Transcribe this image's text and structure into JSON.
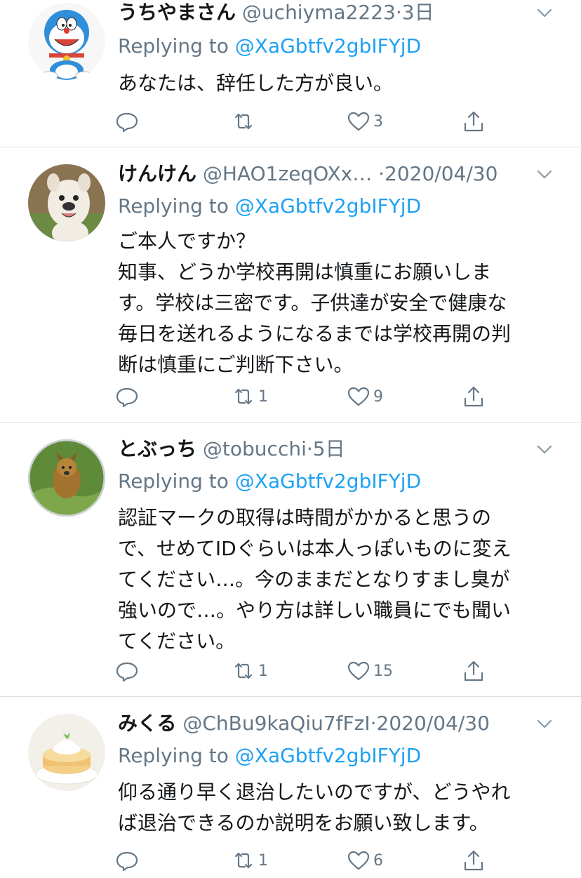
{
  "tweets": [
    {
      "name": "うちやまさん",
      "handle": "@uchiyma2223",
      "sep": "·",
      "time": "3日",
      "reply_prefix": "Replying to ",
      "reply_to": "@XaGbtfv2gbIFYjD",
      "lines": [
        "あなたは、辞任した方が良い。"
      ],
      "counts": {
        "reply": "",
        "retweet": "",
        "like": "3"
      },
      "avatar": "doraemon-avatar"
    },
    {
      "name": "けんけん",
      "handle": "@HAO1zeqOXx…",
      "sep": " ·",
      "time": "2020/04/30",
      "reply_prefix": "Replying to ",
      "reply_to": "@XaGbtfv2gbIFYjD",
      "lines": [
        "ご本人ですか？",
        "知事、どうか学校再開は慎重にお願いしま",
        "す。学校は三密です。子供達が安全で健康な",
        "毎日を送れるようになるまでは学校再開の判",
        "断は慎重にご判断下さい。"
      ],
      "counts": {
        "reply": "",
        "retweet": "1",
        "like": "9"
      },
      "avatar": "bulldog-avatar"
    },
    {
      "name": "とぶっち",
      "handle": "@tobucchi",
      "sep": "·",
      "time": "5日",
      "reply_prefix": "Replying to ",
      "reply_to": "@XaGbtfv2gbIFYjD",
      "lines": [
        "認証マークの取得は時間がかかると思うの",
        "で、せめてIDぐらいは本人っぽいものに変え",
        "てください…。今のままだとなりすまし臭が",
        "強いので…。やり方は詳しい職員にでも聞い",
        "てください。"
      ],
      "counts": {
        "reply": "",
        "retweet": "1",
        "like": "15"
      },
      "avatar": "dog-avatar"
    },
    {
      "name": "みくる",
      "handle": "@ChBu9kaQiu7fFzI",
      "sep": "·",
      "time": "2020/04/30",
      "reply_prefix": "Replying to ",
      "reply_to": "@XaGbtfv2gbIFYjD",
      "lines": [
        "仰る通り早く退治したいのですが、どうやれ",
        "ば退治できるのか説明をお願い致します。"
      ],
      "counts": {
        "reply": "",
        "retweet": "1",
        "like": "6"
      },
      "avatar": "pancake-avatar"
    }
  ],
  "colors": {
    "text": "#14171a",
    "secondary": "#657786",
    "link": "#1da1f2",
    "divider": "#dbdfe3"
  },
  "icons": [
    "reply-icon",
    "retweet-icon",
    "like-icon",
    "share-icon",
    "chevron-down-icon"
  ]
}
